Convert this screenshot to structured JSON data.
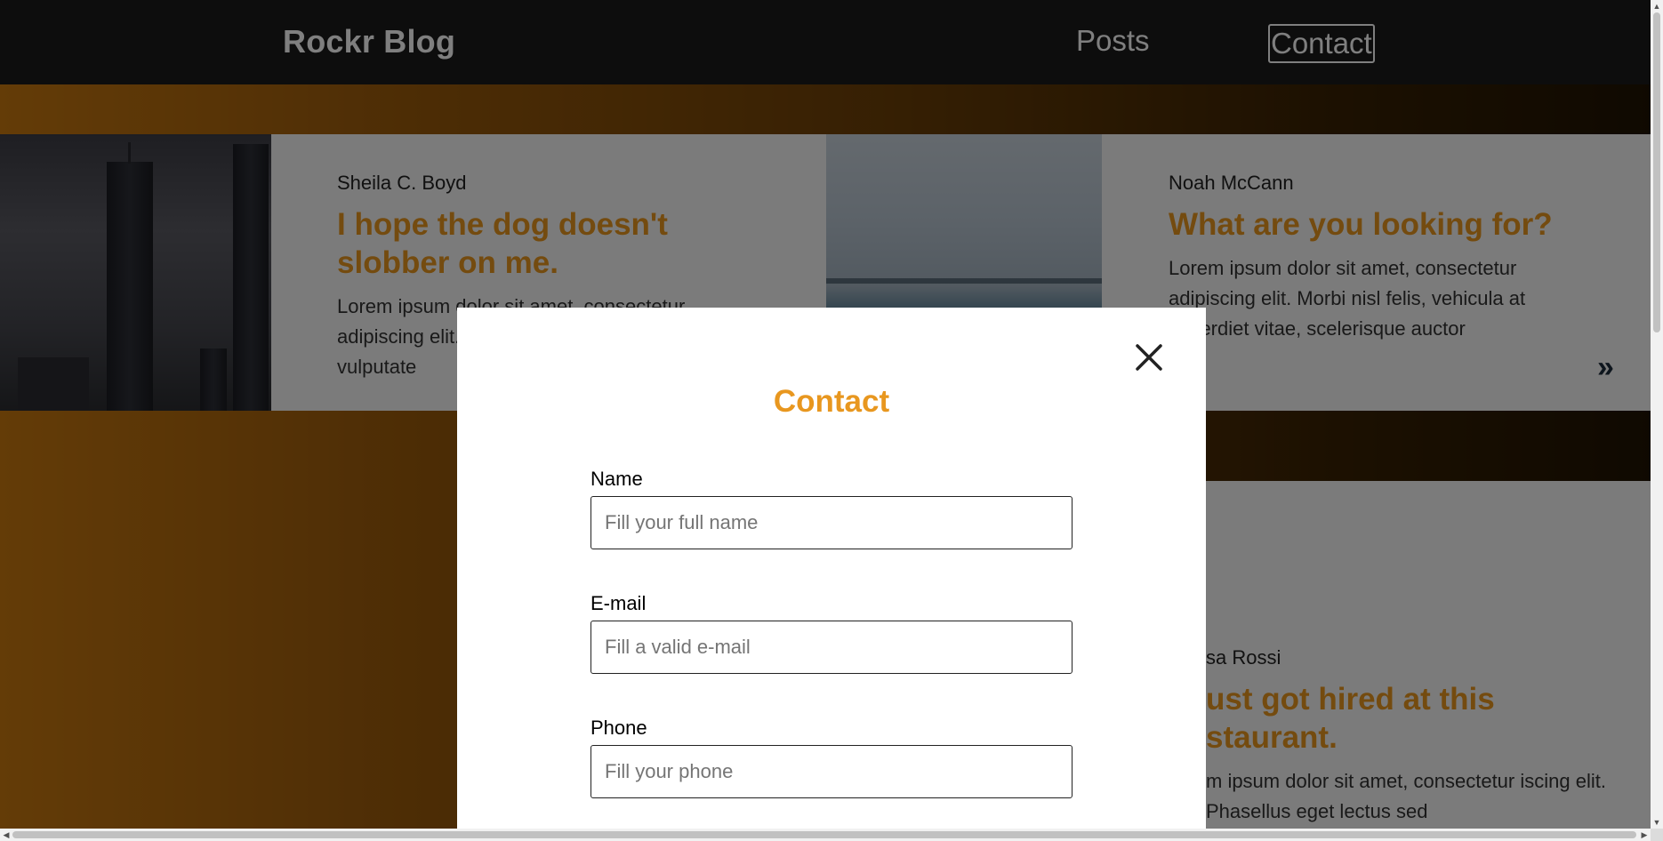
{
  "header": {
    "brand": "Rockr Blog",
    "nav": {
      "posts": "Posts",
      "contact": "Contact"
    }
  },
  "posts": [
    {
      "author": "Sheila C. Boyd",
      "title": "I hope the dog doesn't slobber on me.",
      "excerpt": "Lorem ipsum dolor sit amet, consectetur adipiscing elit. Morbi nisl felis, vehicula erat vulputate",
      "image": "city-skyline-image"
    },
    {
      "author": "Noah McCann",
      "title": "What are you looking for?",
      "excerpt": "Lorem ipsum dolor sit amet, consectetur adipiscing elit. Morbi nisl felis, vehicula at imperdiet vitae, scelerisque auctor",
      "image": "sea-horizon-image"
    },
    {
      "author": "sa Rossi",
      "title": "ust got hired at this staurant.",
      "excerpt": "m ipsum dolor sit amet, consectetur iscing elit. Phasellus eget lectus sed"
    }
  ],
  "carousel": {
    "next_icon": "double-chevron-right-icon",
    "next_glyph": "»"
  },
  "modal": {
    "title": "Contact",
    "close_icon": "close-icon",
    "fields": {
      "name": {
        "label": "Name",
        "placeholder": "Fill your full name",
        "value": ""
      },
      "email": {
        "label": "E-mail",
        "placeholder": "Fill a valid e-mail",
        "value": ""
      },
      "phone": {
        "label": "Phone",
        "placeholder": "Fill your phone",
        "value": ""
      }
    }
  },
  "colors": {
    "accent": "#e8971f",
    "header_bg": "#1b1b1b",
    "card_bg": "#f6f6f6",
    "gradient_start": "#c8780f",
    "gradient_end": "#1f1302"
  }
}
